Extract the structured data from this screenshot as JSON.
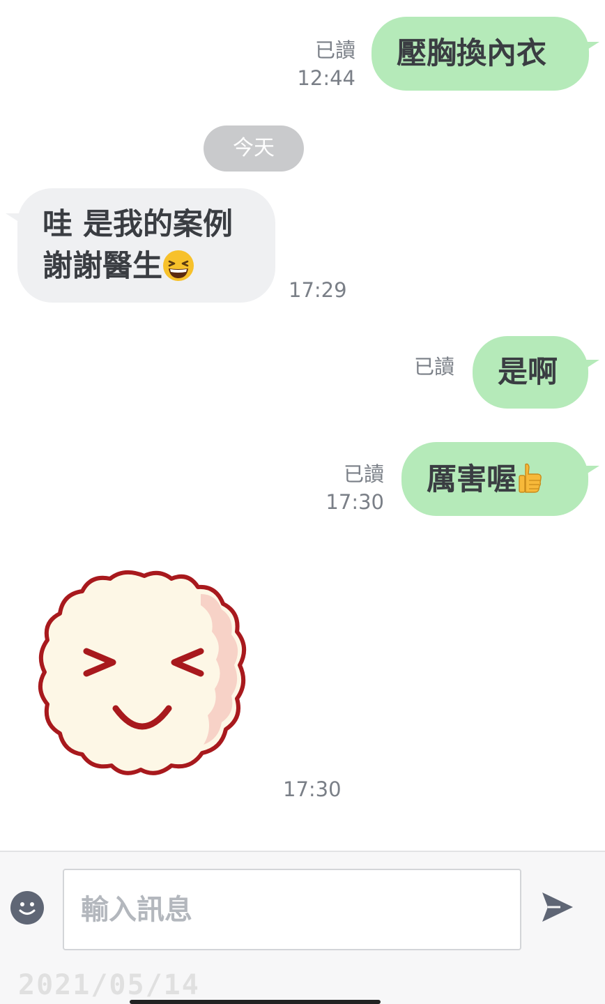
{
  "messages": [
    {
      "text": "壓胸換內衣",
      "read": "已讀",
      "time": "12:44"
    },
    {
      "text": "是啊",
      "read": "已讀"
    },
    {
      "text": "厲害喔",
      "emoji": "thumbs-up-icon",
      "read": "已讀",
      "time": "17:30"
    }
  ],
  "date_divider": "今天",
  "incoming": {
    "line1": "哇 是我的案例",
    "line2": "謝謝醫生",
    "emoji": "grinning-squinting-icon",
    "time": "17:29"
  },
  "sticker": {
    "icon": "smiling-cloud-sticker",
    "time": "17:30"
  },
  "composer": {
    "placeholder": "輸入訊息",
    "emoji_icon": "smiley-icon",
    "send_icon": "send-icon"
  },
  "watermark": "2021/05/14",
  "colors": {
    "outgoing_bubble": "#b5eab9",
    "incoming_bubble": "#eff0f2",
    "date_pill": "#c9cacc",
    "sticker_outline": "#a8191d"
  }
}
